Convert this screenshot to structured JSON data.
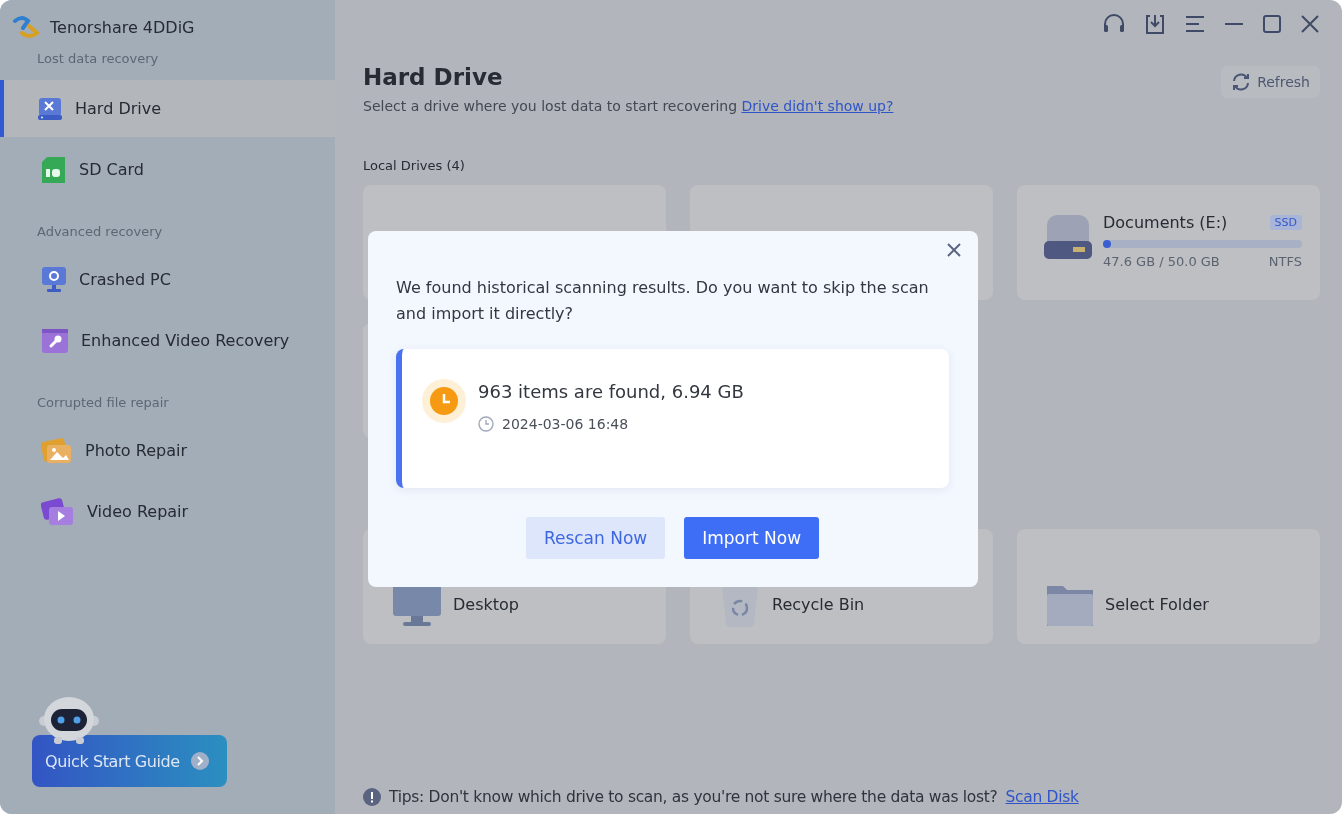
{
  "app": {
    "name": "Tenorshare 4DDiG"
  },
  "sidebar": {
    "sections": [
      {
        "title": "Lost data recovery",
        "items": [
          {
            "label": "Hard Drive",
            "kind": "hdd",
            "selected": true
          },
          {
            "label": "SD Card",
            "kind": "sd",
            "selected": false
          }
        ]
      },
      {
        "title": "Advanced recovery",
        "items": [
          {
            "label": "Crashed PC",
            "kind": "pc",
            "selected": false
          },
          {
            "label": "Enhanced Video Recovery",
            "kind": "videotool",
            "selected": false
          }
        ]
      },
      {
        "title": "Corrupted file repair",
        "items": [
          {
            "label": "Photo Repair",
            "kind": "photo",
            "selected": false
          },
          {
            "label": "Video Repair",
            "kind": "video",
            "selected": false
          }
        ]
      }
    ]
  },
  "quick_start": {
    "label": "Quick Start Guide"
  },
  "page": {
    "title": "Hard Drive",
    "subtitle": "Select a drive where you lost data to start recovering",
    "help_link": "Drive didn't show up?",
    "refresh": "Refresh",
    "local_drives_heading": "Local Drives (4)"
  },
  "drive": {
    "name": "Documents (E:)",
    "badge": "SSD",
    "level": 0.02,
    "usage": "47.6 GB / 50.0 GB",
    "filesystem": "NTFS"
  },
  "locations": [
    {
      "kind": "desktop",
      "label": "Desktop"
    },
    {
      "kind": "recycle",
      "label": "Recycle Bin"
    },
    {
      "kind": "folder",
      "label": "Select Folder"
    }
  ],
  "tips": {
    "text": "Tips: Don't know which drive to scan, as you're not sure where the data was lost?",
    "link": "Scan Disk"
  },
  "dialog": {
    "message": "We found historical scanning results. Do you want to skip the scan and import it directly?",
    "summary": "963 items are found, 6.94 GB",
    "time": "2024-03-06 16:48",
    "buttons": [
      {
        "label": "Rescan Now",
        "kind": "secondary"
      },
      {
        "label": "Import Now",
        "kind": "primary"
      }
    ]
  }
}
